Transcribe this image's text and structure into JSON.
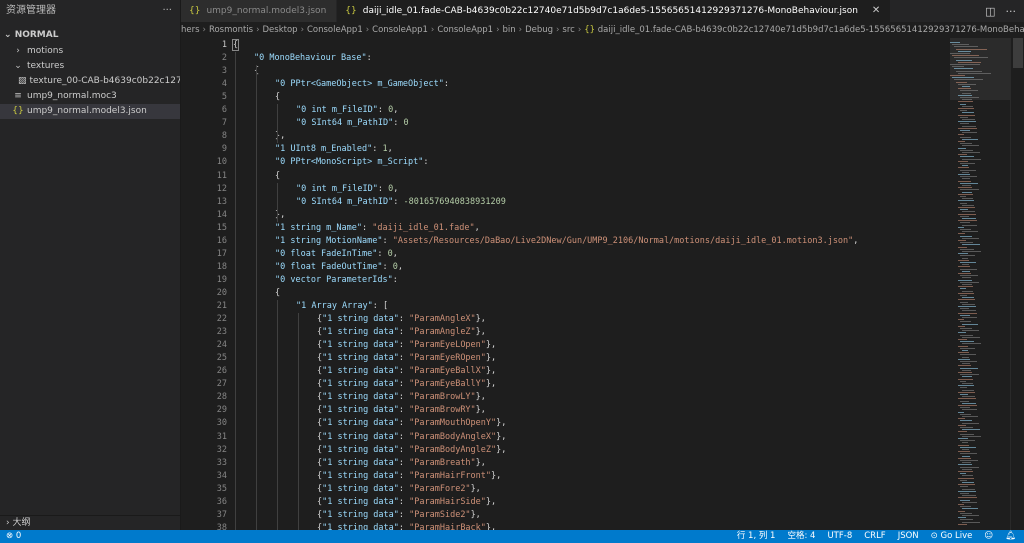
{
  "sidebar": {
    "title": "资源管理器",
    "more_icon": "ellipsis-icon",
    "section": "NORMAL",
    "items": [
      {
        "label": "motions",
        "icon": "chevron-right-icon",
        "indent": 1
      },
      {
        "label": "textures",
        "icon": "chevron-down-icon",
        "indent": 1
      },
      {
        "label": "texture_00-CAB-b4639c0b22c12740...",
        "icon": "image-icon",
        "indent": 2
      },
      {
        "label": "ump9_normal.moc3",
        "icon": "file-icon",
        "indent": 1
      },
      {
        "label": "ump9_normal.model3.json",
        "icon": "json-braces-icon",
        "indent": 1,
        "selected": true
      }
    ],
    "outline_label": "大纲"
  },
  "tabs": [
    {
      "label": "ump9_normal.model3.json",
      "active": false
    },
    {
      "label": "daiji_idle_01.fade-CAB-b4639c0b22c12740e71d5b9d7c1a6de5-1556565141292937​1276-MonoBehaviour.json",
      "active": true
    }
  ],
  "breadcrumb": [
    "hers",
    "Rosmontis",
    "Desktop",
    "ConsoleApp1",
    "ConsoleApp1",
    "ConsoleApp1",
    "bin",
    "Debug",
    "src",
    "daiji_idle_01.fade-CAB-b4639c0b22c12740e71d5b9d7c1a6de5-15565651412929371276-MonoBehaviour.json"
  ],
  "editor": {
    "lines": [
      {
        "n": "1",
        "indent": 0,
        "segs": [
          {
            "t": "{",
            "c": "p"
          }
        ]
      },
      {
        "n": "2",
        "indent": 1,
        "segs": [
          {
            "t": "\"0 MonoBehaviour Base\"",
            "c": "k"
          },
          {
            "t": ":",
            "c": "p"
          }
        ]
      },
      {
        "n": "3",
        "indent": 1,
        "segs": [
          {
            "t": "{",
            "c": "p"
          }
        ]
      },
      {
        "n": "4",
        "indent": 2,
        "segs": [
          {
            "t": "\"0 PPtr<GameObject> m_GameObject\"",
            "c": "k"
          },
          {
            "t": ":",
            "c": "p"
          }
        ]
      },
      {
        "n": "5",
        "indent": 2,
        "segs": [
          {
            "t": "{",
            "c": "p"
          }
        ]
      },
      {
        "n": "6",
        "indent": 3,
        "segs": [
          {
            "t": "\"0 int m_FileID\"",
            "c": "k"
          },
          {
            "t": ": ",
            "c": "p"
          },
          {
            "t": "0",
            "c": "n"
          },
          {
            "t": ",",
            "c": "p"
          }
        ]
      },
      {
        "n": "7",
        "indent": 3,
        "segs": [
          {
            "t": "\"0 SInt64 m_PathID\"",
            "c": "k"
          },
          {
            "t": ": ",
            "c": "p"
          },
          {
            "t": "0",
            "c": "n"
          }
        ]
      },
      {
        "n": "8",
        "indent": 2,
        "segs": [
          {
            "t": "},",
            "c": "p"
          }
        ]
      },
      {
        "n": "9",
        "indent": 2,
        "segs": [
          {
            "t": "\"1 UInt8 m_Enabled\"",
            "c": "k"
          },
          {
            "t": ": ",
            "c": "p"
          },
          {
            "t": "1",
            "c": "n"
          },
          {
            "t": ",",
            "c": "p"
          }
        ]
      },
      {
        "n": "10",
        "indent": 2,
        "segs": [
          {
            "t": "\"0 PPtr<MonoScript> m_Script\"",
            "c": "k"
          },
          {
            "t": ":",
            "c": "p"
          }
        ]
      },
      {
        "n": "11",
        "indent": 2,
        "segs": [
          {
            "t": "{",
            "c": "p"
          }
        ]
      },
      {
        "n": "12",
        "indent": 3,
        "segs": [
          {
            "t": "\"0 int m_FileID\"",
            "c": "k"
          },
          {
            "t": ": ",
            "c": "p"
          },
          {
            "t": "0",
            "c": "n"
          },
          {
            "t": ",",
            "c": "p"
          }
        ]
      },
      {
        "n": "13",
        "indent": 3,
        "segs": [
          {
            "t": "\"0 SInt64 m_PathID\"",
            "c": "k"
          },
          {
            "t": ": ",
            "c": "p"
          },
          {
            "t": "-801657694083893​1209",
            "c": "n"
          }
        ]
      },
      {
        "n": "14",
        "indent": 2,
        "segs": [
          {
            "t": "},",
            "c": "p"
          }
        ]
      },
      {
        "n": "15",
        "indent": 2,
        "segs": [
          {
            "t": "\"1 string m_Name\"",
            "c": "k"
          },
          {
            "t": ": ",
            "c": "p"
          },
          {
            "t": "\"daiji_idle_01.fade\"",
            "c": "s"
          },
          {
            "t": ",",
            "c": "p"
          }
        ]
      },
      {
        "n": "16",
        "indent": 2,
        "segs": [
          {
            "t": "\"1 string MotionName\"",
            "c": "k"
          },
          {
            "t": ": ",
            "c": "p"
          },
          {
            "t": "\"Assets/Resources/DaBao/Live2DNew/Gun/UMP9_2106/Normal/motions/daiji_idle_01.motion3.json\"",
            "c": "s"
          },
          {
            "t": ",",
            "c": "p"
          }
        ]
      },
      {
        "n": "17",
        "indent": 2,
        "segs": [
          {
            "t": "\"0 float FadeInTime\"",
            "c": "k"
          },
          {
            "t": ": ",
            "c": "p"
          },
          {
            "t": "0",
            "c": "n"
          },
          {
            "t": ",",
            "c": "p"
          }
        ]
      },
      {
        "n": "18",
        "indent": 2,
        "segs": [
          {
            "t": "\"0 float FadeOutTime\"",
            "c": "k"
          },
          {
            "t": ": ",
            "c": "p"
          },
          {
            "t": "0",
            "c": "n"
          },
          {
            "t": ",",
            "c": "p"
          }
        ]
      },
      {
        "n": "19",
        "indent": 2,
        "segs": [
          {
            "t": "\"0 vector ParameterIds\"",
            "c": "k"
          },
          {
            "t": ":",
            "c": "p"
          }
        ]
      },
      {
        "n": "20",
        "indent": 2,
        "segs": [
          {
            "t": "{",
            "c": "p"
          }
        ]
      },
      {
        "n": "21",
        "indent": 3,
        "segs": [
          {
            "t": "\"1 Array Array\"",
            "c": "k"
          },
          {
            "t": ": [",
            "c": "p"
          }
        ]
      },
      {
        "n": "22",
        "indent": 4,
        "segs": [
          {
            "t": "{",
            "c": "p"
          },
          {
            "t": "\"1 string data\"",
            "c": "k"
          },
          {
            "t": ": ",
            "c": "p"
          },
          {
            "t": "\"ParamAngleX\"",
            "c": "s"
          },
          {
            "t": "},",
            "c": "p"
          }
        ]
      },
      {
        "n": "23",
        "indent": 4,
        "segs": [
          {
            "t": "{",
            "c": "p"
          },
          {
            "t": "\"1 string data\"",
            "c": "k"
          },
          {
            "t": ": ",
            "c": "p"
          },
          {
            "t": "\"ParamAngleZ\"",
            "c": "s"
          },
          {
            "t": "},",
            "c": "p"
          }
        ]
      },
      {
        "n": "24",
        "indent": 4,
        "segs": [
          {
            "t": "{",
            "c": "p"
          },
          {
            "t": "\"1 string data\"",
            "c": "k"
          },
          {
            "t": ": ",
            "c": "p"
          },
          {
            "t": "\"ParamEyeLOpen\"",
            "c": "s"
          },
          {
            "t": "},",
            "c": "p"
          }
        ]
      },
      {
        "n": "25",
        "indent": 4,
        "segs": [
          {
            "t": "{",
            "c": "p"
          },
          {
            "t": "\"1 string data\"",
            "c": "k"
          },
          {
            "t": ": ",
            "c": "p"
          },
          {
            "t": "\"ParamEyeROpen\"",
            "c": "s"
          },
          {
            "t": "},",
            "c": "p"
          }
        ]
      },
      {
        "n": "26",
        "indent": 4,
        "segs": [
          {
            "t": "{",
            "c": "p"
          },
          {
            "t": "\"1 string data\"",
            "c": "k"
          },
          {
            "t": ": ",
            "c": "p"
          },
          {
            "t": "\"ParamEyeBallX\"",
            "c": "s"
          },
          {
            "t": "},",
            "c": "p"
          }
        ]
      },
      {
        "n": "27",
        "indent": 4,
        "segs": [
          {
            "t": "{",
            "c": "p"
          },
          {
            "t": "\"1 string data\"",
            "c": "k"
          },
          {
            "t": ": ",
            "c": "p"
          },
          {
            "t": "\"ParamEyeBallY\"",
            "c": "s"
          },
          {
            "t": "},",
            "c": "p"
          }
        ]
      },
      {
        "n": "28",
        "indent": 4,
        "segs": [
          {
            "t": "{",
            "c": "p"
          },
          {
            "t": "\"1 string data\"",
            "c": "k"
          },
          {
            "t": ": ",
            "c": "p"
          },
          {
            "t": "\"ParamBrowLY\"",
            "c": "s"
          },
          {
            "t": "},",
            "c": "p"
          }
        ]
      },
      {
        "n": "29",
        "indent": 4,
        "segs": [
          {
            "t": "{",
            "c": "p"
          },
          {
            "t": "\"1 string data\"",
            "c": "k"
          },
          {
            "t": ": ",
            "c": "p"
          },
          {
            "t": "\"ParamBrowRY\"",
            "c": "s"
          },
          {
            "t": "},",
            "c": "p"
          }
        ]
      },
      {
        "n": "30",
        "indent": 4,
        "segs": [
          {
            "t": "{",
            "c": "p"
          },
          {
            "t": "\"1 string data\"",
            "c": "k"
          },
          {
            "t": ": ",
            "c": "p"
          },
          {
            "t": "\"ParamMouthOpenY\"",
            "c": "s"
          },
          {
            "t": "},",
            "c": "p"
          }
        ]
      },
      {
        "n": "31",
        "indent": 4,
        "segs": [
          {
            "t": "{",
            "c": "p"
          },
          {
            "t": "\"1 string data\"",
            "c": "k"
          },
          {
            "t": ": ",
            "c": "p"
          },
          {
            "t": "\"ParamBodyAngleX\"",
            "c": "s"
          },
          {
            "t": "},",
            "c": "p"
          }
        ]
      },
      {
        "n": "32",
        "indent": 4,
        "segs": [
          {
            "t": "{",
            "c": "p"
          },
          {
            "t": "\"1 string data\"",
            "c": "k"
          },
          {
            "t": ": ",
            "c": "p"
          },
          {
            "t": "\"ParamBodyAngleZ\"",
            "c": "s"
          },
          {
            "t": "},",
            "c": "p"
          }
        ]
      },
      {
        "n": "33",
        "indent": 4,
        "segs": [
          {
            "t": "{",
            "c": "p"
          },
          {
            "t": "\"1 string data\"",
            "c": "k"
          },
          {
            "t": ": ",
            "c": "p"
          },
          {
            "t": "\"ParamBreath\"",
            "c": "s"
          },
          {
            "t": "},",
            "c": "p"
          }
        ]
      },
      {
        "n": "34",
        "indent": 4,
        "segs": [
          {
            "t": "{",
            "c": "p"
          },
          {
            "t": "\"1 string data\"",
            "c": "k"
          },
          {
            "t": ": ",
            "c": "p"
          },
          {
            "t": "\"ParamHairFront\"",
            "c": "s"
          },
          {
            "t": "},",
            "c": "p"
          }
        ]
      },
      {
        "n": "35",
        "indent": 4,
        "segs": [
          {
            "t": "{",
            "c": "p"
          },
          {
            "t": "\"1 string data\"",
            "c": "k"
          },
          {
            "t": ": ",
            "c": "p"
          },
          {
            "t": "\"ParamFore2\"",
            "c": "s"
          },
          {
            "t": "},",
            "c": "p"
          }
        ]
      },
      {
        "n": "36",
        "indent": 4,
        "segs": [
          {
            "t": "{",
            "c": "p"
          },
          {
            "t": "\"1 string data\"",
            "c": "k"
          },
          {
            "t": ": ",
            "c": "p"
          },
          {
            "t": "\"ParamHairSide\"",
            "c": "s"
          },
          {
            "t": "},",
            "c": "p"
          }
        ]
      },
      {
        "n": "37",
        "indent": 4,
        "segs": [
          {
            "t": "{",
            "c": "p"
          },
          {
            "t": "\"1 string data\"",
            "c": "k"
          },
          {
            "t": ": ",
            "c": "p"
          },
          {
            "t": "\"ParamSide2\"",
            "c": "s"
          },
          {
            "t": "},",
            "c": "p"
          }
        ]
      },
      {
        "n": "38",
        "indent": 4,
        "segs": [
          {
            "t": "{",
            "c": "p"
          },
          {
            "t": "\"1 string data\"",
            "c": "k"
          },
          {
            "t": ": ",
            "c": "p"
          },
          {
            "t": "\"ParamHairBack\"",
            "c": "s"
          },
          {
            "t": "},",
            "c": "p"
          }
        ]
      }
    ]
  },
  "statusbar": {
    "left": "⊗ 0",
    "items": [
      "行 1, 列 1",
      "空格: 4",
      "UTF-8",
      "CRLF",
      "JSON",
      "Go Live"
    ],
    "icons": [
      "bell-icon",
      "feedback-icon"
    ]
  },
  "colors": {
    "accent": "#007acc",
    "key": "#9cdcfe",
    "string": "#ce9178",
    "number": "#b5cea8",
    "json_icon": "#cbcb41"
  }
}
